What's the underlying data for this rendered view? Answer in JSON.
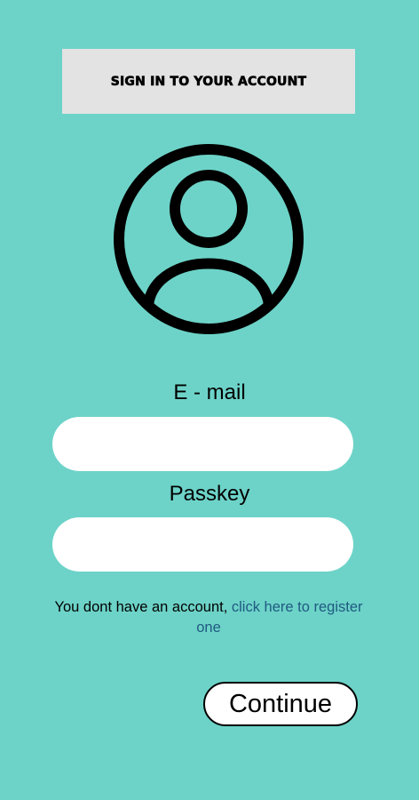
{
  "header": {
    "title": "SIGN IN TO YOUR ACCOUNT"
  },
  "avatar": {
    "icon": "user-circle-icon"
  },
  "form": {
    "email_label": "E - mail",
    "email_value": "",
    "passkey_label": "Passkey",
    "passkey_value": ""
  },
  "register": {
    "prefix": "You dont have an account, ",
    "link": "click here to register one"
  },
  "actions": {
    "continue_label": "Continue"
  },
  "colors": {
    "background": "#6dd3c8",
    "title_box": "#e3e3e3",
    "link": "#1f5a82",
    "input": "#ffffff"
  }
}
